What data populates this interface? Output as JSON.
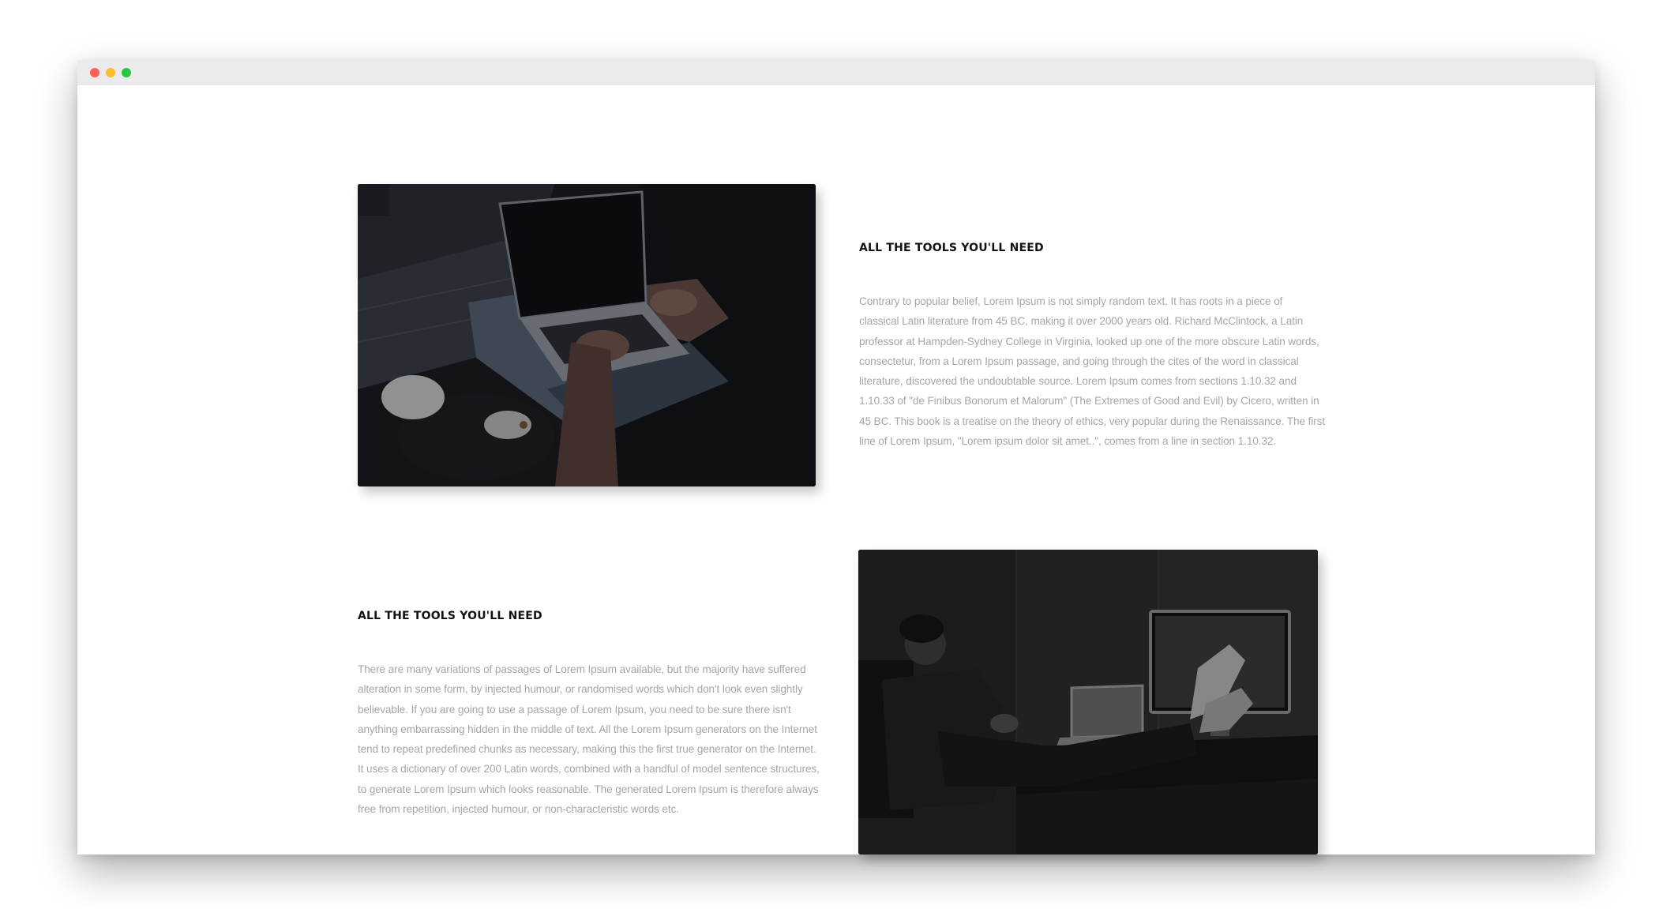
{
  "browser": {
    "controls": [
      "close",
      "minimize",
      "maximize"
    ],
    "colors": {
      "close": "#fe5f57",
      "minimize": "#febc2e",
      "maximize": "#28c840"
    }
  },
  "features": [
    {
      "heading": "ALL THE TOOLS YOU'LL NEED",
      "body": "Contrary to popular belief, Lorem Ipsum is not simply random text. It has roots in a piece of classical Latin literature from 45 BC, making it over 2000 years old. Richard McClintock, a Latin professor at Hampden-Sydney College in Virginia, looked up one of the more obscure Latin words, consectetur, from a Lorem Ipsum passage, and going through the cites of the word in classical literature, discovered the undoubtable source. Lorem Ipsum comes from sections 1.10.32 and 1.10.33 of \"de Finibus Bonorum et Malorum\" (The Extremes of Good and Evil) by Cicero, written in 45 BC. This book is a treatise on the theory of ethics, very popular during the Renaissance. The first line of Lorem Ipsum, \"Lorem ipsum dolor sit amet..\", comes from a line in section 1.10.32.",
      "image_icon": "laptop-photo"
    },
    {
      "heading": "ALL THE TOOLS YOU'LL NEED",
      "body": "There are many variations of passages of Lorem Ipsum available, but the majority have suffered alteration in some form, by injected humour, or randomised words which don't look even slightly believable. If you are going to use a passage of Lorem Ipsum, you need to be sure there isn't anything embarrassing hidden in the middle of text. All the Lorem Ipsum generators on the Internet tend to repeat predefined chunks as necessary, making this the first true generator on the Internet. It uses a dictionary of over 200 Latin words, combined with a handful of model sentence structures, to generate Lorem Ipsum which looks reasonable. The generated Lorem Ipsum is therefore always free from repetition, injected humour, or non-characteristic words etc.",
      "image_icon": "office-photo"
    }
  ]
}
